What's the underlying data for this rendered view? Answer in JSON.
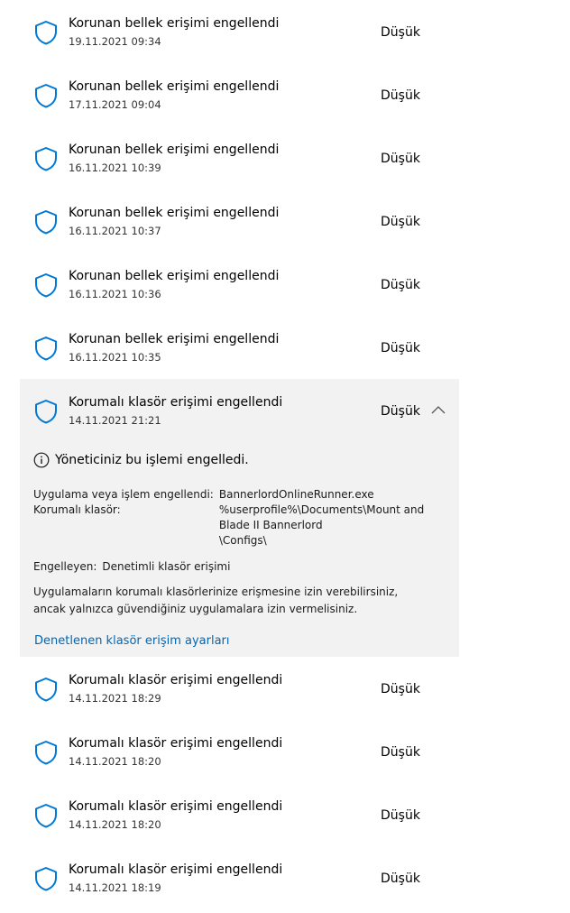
{
  "items_before": [
    {
      "title": "Korunan bellek erişimi engellendi",
      "date": "19.11.2021 09:34",
      "severity": "Düşük"
    },
    {
      "title": "Korunan bellek erişimi engellendi",
      "date": "17.11.2021 09:04",
      "severity": "Düşük"
    },
    {
      "title": "Korunan bellek erişimi engellendi",
      "date": "16.11.2021 10:39",
      "severity": "Düşük"
    },
    {
      "title": "Korunan bellek erişimi engellendi",
      "date": "16.11.2021 10:37",
      "severity": "Düşük"
    },
    {
      "title": "Korunan bellek erişimi engellendi",
      "date": "16.11.2021 10:36",
      "severity": "Düşük"
    },
    {
      "title": "Korunan bellek erişimi engellendi",
      "date": "16.11.2021 10:35",
      "severity": "Düşük"
    }
  ],
  "expanded_item": {
    "title": "Korumalı klasör erişimi engellendi",
    "date": "14.11.2021 21:21",
    "severity": "Düşük",
    "admin_message": "Yöneticiniz bu işlemi engelledi.",
    "app_label": "Uygulama veya işlem engellendi:",
    "app_value": "BannerlordOnlineRunner.exe",
    "folder_label": "Korumalı klasör:",
    "folder_value": "%userprofile%\\Documents\\Mount and Blade II Bannerlord\n\\Configs\\",
    "blocked_by_label": "Engelleyen:",
    "blocked_by_value": "Denetimli klasör erişimi",
    "description": "Uygulamaların korumalı klasörlerinize erişmesine izin verebilirsiniz, ancak yalnızca güvendiğiniz uygulamalara izin vermelisiniz.",
    "settings_link": "Denetlenen klasör erişim ayarları"
  },
  "items_after": [
    {
      "title": "Korumalı klasör erişimi engellendi",
      "date": "14.11.2021 18:29",
      "severity": "Düşük"
    },
    {
      "title": "Korumalı klasör erişimi engellendi",
      "date": "14.11.2021 18:20",
      "severity": "Düşük"
    },
    {
      "title": "Korumalı klasör erişimi engellendi",
      "date": "14.11.2021 18:20",
      "severity": "Düşük"
    },
    {
      "title": "Korumalı klasör erişimi engellendi",
      "date": "14.11.2021 18:19",
      "severity": "Düşük"
    }
  ],
  "icons": {
    "item_icon": "shield-icon",
    "expand_icon": "chevron-up-icon",
    "info_icon": "info-icon"
  },
  "colors": {
    "shield": "#0078d4",
    "link": "#0066b4",
    "expanded_bg": "#f2f2f2"
  }
}
